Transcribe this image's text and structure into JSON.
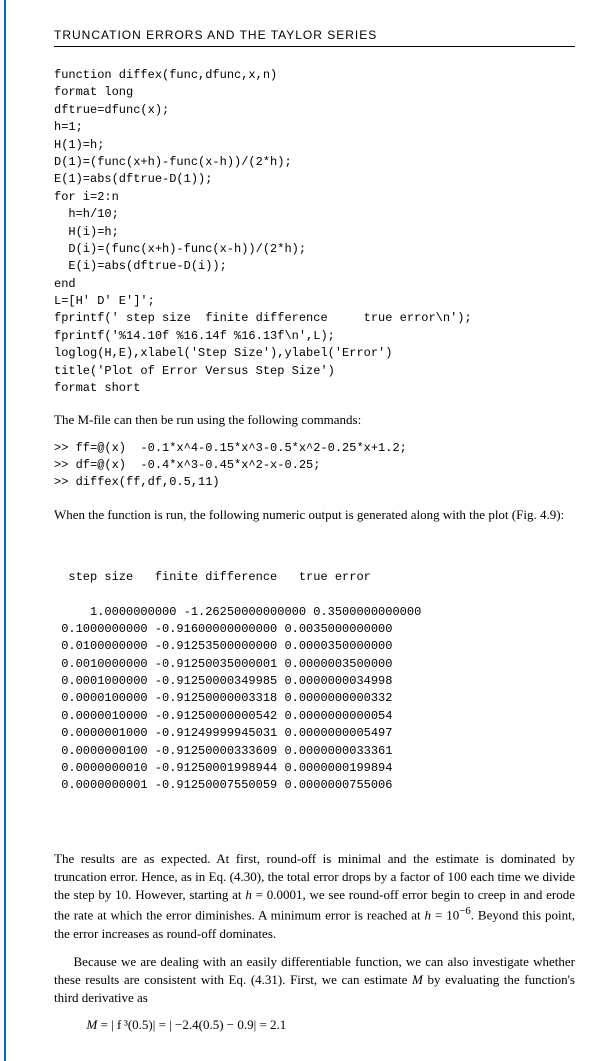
{
  "header": "TRUNCATION ERRORS AND THE TAYLOR SERIES",
  "code_block_1": "function diffex(func,dfunc,x,n)\nformat long\ndftrue=dfunc(x);\nh=1;\nH(1)=h;\nD(1)=(func(x+h)-func(x-h))/(2*h);\nE(1)=abs(dftrue-D(1));\nfor i=2:n\n  h=h/10;\n  H(i)=h;\n  D(i)=(func(x+h)-func(x-h))/(2*h);\n  E(i)=abs(dftrue-D(i));\nend\nL=[H' D' E']';\nfprintf(' step size  finite difference     true error\\n');\nfprintf('%14.10f %16.14f %16.13f\\n',L);\nloglog(H,E),xlabel('Step Size'),ylabel('Error')\ntitle('Plot of Error Versus Step Size')\nformat short",
  "para_1": "The M-file can then be run using the following commands:",
  "code_block_2": ">> ff=@(x)  -0.1*x^4-0.15*x^3-0.5*x^2-0.25*x+1.2;\n>> df=@(x)  -0.4*x^3-0.45*x^2-x-0.25;\n>> diffex(ff,df,0.5,11)",
  "para_2": "When the function is run, the following numeric output is generated along with the plot (Fig. 4.9):",
  "output_header": "  step size   finite difference   true error",
  "chart_data": {
    "type": "table",
    "columns": [
      "step size",
      "finite difference",
      "true error"
    ],
    "rows": [
      {
        "step": "1.0000000000",
        "fd": "-1.26250000000000",
        "err": "0.3500000000000"
      },
      {
        "step": "0.1000000000",
        "fd": "-0.91600000000000",
        "err": "0.0035000000000"
      },
      {
        "step": "0.0100000000",
        "fd": "-0.91253500000000",
        "err": "0.0000350000000"
      },
      {
        "step": "0.0010000000",
        "fd": "-0.91250035000001",
        "err": "0.0000003500000"
      },
      {
        "step": "0.0001000000",
        "fd": "-0.91250000349985",
        "err": "0.0000000034998"
      },
      {
        "step": "0.0000100000",
        "fd": "-0.91250000003318",
        "err": "0.0000000000332"
      },
      {
        "step": "0.0000010000",
        "fd": "-0.91250000000542",
        "err": "0.0000000000054"
      },
      {
        "step": "0.0000001000",
        "fd": "-0.91249999945031",
        "err": "0.0000000005497"
      },
      {
        "step": "0.0000000100",
        "fd": "-0.91250000333609",
        "err": "0.0000000033361"
      },
      {
        "step": "0.0000000010",
        "fd": "-0.91250001998944",
        "err": "0.0000000199894"
      },
      {
        "step": "0.0000000001",
        "fd": "-0.91250007550059",
        "err": "0.0000000755006"
      }
    ]
  },
  "para_3_a": "The results are as expected. At first, round-off is minimal and the estimate is dominated by truncation error. Hence, as in Eq. (4.30), the total error drops by a factor of 100 each time we divide the step by 10. However, starting at ",
  "para_3_b": " = 0.0001, we see round-off error begin to creep in and erode the rate at which the error diminishes. A minimum error is reached at ",
  "para_3_c": ". Beyond this point, the error increases as round-off dominates.",
  "para_4_a": "Because we are dealing with an easily differentiable function, we can also investigate whether these results are consistent with Eq. (4.31). First, we can estimate ",
  "para_4_b": " by evaluating the function's third derivative as",
  "math_M": "M",
  "math_eq": " = | f ³(0.5)| = | −2.4(0.5) − 0.9| = 2.1",
  "h_label": "h",
  "h_val": " = 10",
  "h_exp": "−6"
}
